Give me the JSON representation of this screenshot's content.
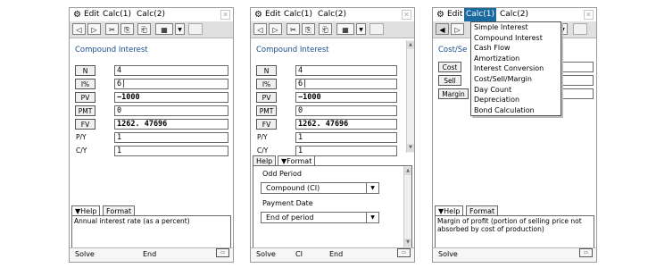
{
  "screen1": {
    "menu": {
      "gear": "⚙",
      "edit": "Edit",
      "calc1": "Calc(1)",
      "calc2": "Calc(2)"
    },
    "title": "Compound Interest",
    "fields": [
      {
        "label": "N",
        "value": "4"
      },
      {
        "label": "I%",
        "value": "6|"
      },
      {
        "label": "PV",
        "value": "−1000"
      },
      {
        "label": "PMT",
        "value": "0"
      },
      {
        "label": "FV",
        "value": "1262. 47696"
      }
    ],
    "settings": [
      {
        "label": "P/Y",
        "value": "1"
      },
      {
        "label": "C/Y",
        "value": "1"
      }
    ],
    "tabs": {
      "help": "▼Help",
      "format": "Format"
    },
    "help_text": "Annual interest rate (as a percent)",
    "status": {
      "left": "Solve",
      "middle": "End"
    }
  },
  "screen2": {
    "menu": {
      "gear": "⚙",
      "edit": "Edit",
      "calc1": "Calc(1)",
      "calc2": "Calc(2)"
    },
    "title": "Compound Interest",
    "fields": [
      {
        "label": "N",
        "value": "4"
      },
      {
        "label": "I%",
        "value": "6|"
      },
      {
        "label": "PV",
        "value": "−1000"
      },
      {
        "label": "PMT",
        "value": "0"
      },
      {
        "label": "FV",
        "value": "1262. 47696"
      }
    ],
    "settings": [
      {
        "label": "P/Y",
        "value": "1"
      },
      {
        "label": "C/Y",
        "value": "1"
      }
    ],
    "tabs": {
      "help": "Help",
      "format": "▼Format"
    },
    "format": {
      "odd_period_label": "Odd Period",
      "odd_period_value": "Compound (CI)",
      "payment_date_label": "Payment Date",
      "payment_date_value": "End of period"
    },
    "status": {
      "left": "Solve",
      "middle": "CI",
      "right": "End"
    }
  },
  "screen3": {
    "menu": {
      "gear": "⚙",
      "edit": "Edit",
      "calc1": "Calc(1)",
      "calc2": "Calc(2)"
    },
    "title": "Cost/Se",
    "fields": [
      {
        "label": "Cost"
      },
      {
        "label": "Sell"
      },
      {
        "label": "Margin"
      }
    ],
    "dropdown": [
      "Simple Interest",
      "Compound Interest",
      "Cash Flow",
      "Amortization",
      "Interest Conversion",
      "Cost/Sell/Margin",
      "Day Count",
      "Depreciation",
      "Bond Calculation"
    ],
    "tabs": {
      "help": "▼Help",
      "format": "Format"
    },
    "help_text": "Margin of profit (portion of selling price not absorbed by cost of production)",
    "status": {
      "left": "Solve"
    }
  },
  "icons": {
    "back": "◁",
    "forward": "▷",
    "cut": "✂",
    "copy": "⎘",
    "paste": "⎗",
    "grid": "▦",
    "dropdown": "▼",
    "close": "✕",
    "battery": "▭"
  }
}
